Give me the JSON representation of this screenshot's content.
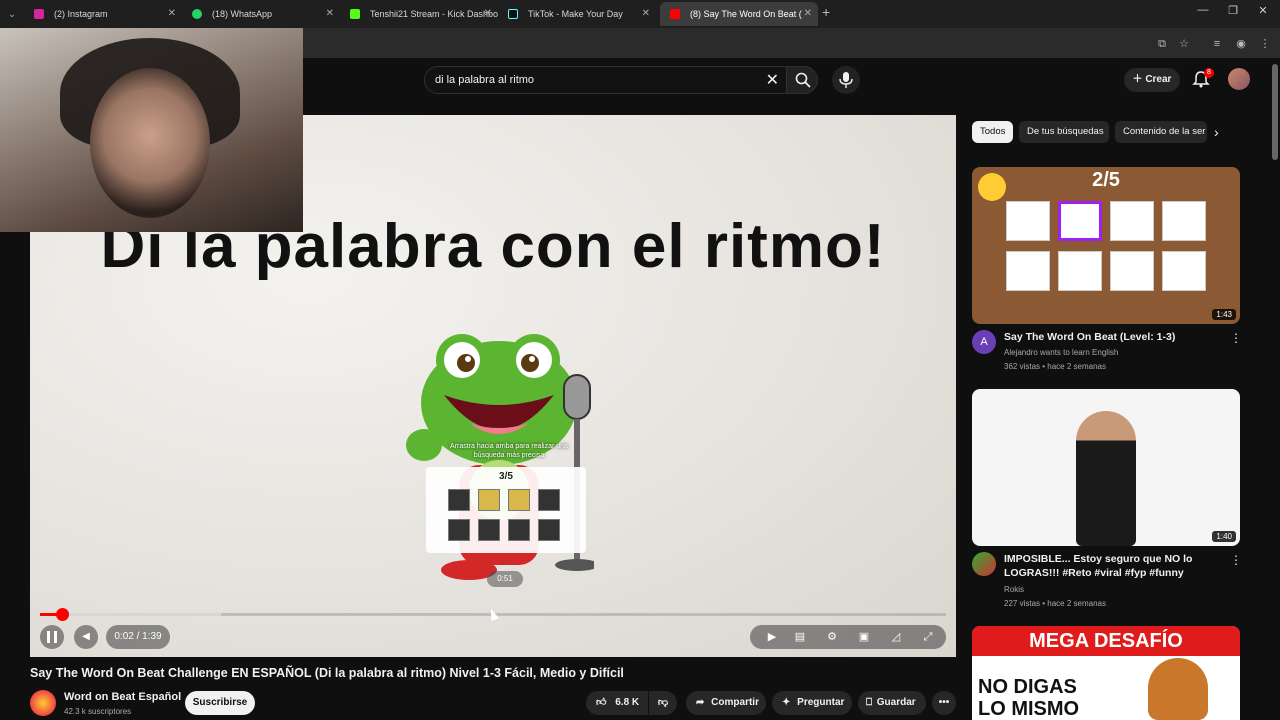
{
  "browser": {
    "tabs": [
      {
        "label": "(2) Instagram",
        "color": "#d6249f"
      },
      {
        "label": "(18) WhatsApp",
        "color": "#25d366"
      },
      {
        "label": "Tenshii21 Stream - Kick Dashbo",
        "color": "#53fc18"
      },
      {
        "label": "TikTok - Make Your Day",
        "color": "#111111"
      },
      {
        "label": "(8) Say The Word On Beat (",
        "color": "#ff0000"
      }
    ],
    "new_tab_label": "+",
    "tab_close": "✕",
    "minimize": "—",
    "restore": "❐",
    "close": "✕"
  },
  "header": {
    "search_value": "di la palabra al ritmo",
    "create_label": "Crear",
    "notif_count": "8"
  },
  "player": {
    "video_title_text": "Di la palabra con el ritmo!",
    "swipe_hint": "Arrastra hacia arriba para realizar una búsqueda más precisa",
    "mini_score": "3/5",
    "hover_time": "0:51",
    "time_display": "0:02 / 1:39",
    "progress_fraction": 0.024,
    "buffer_fraction": 0.2
  },
  "video": {
    "title": "Say The Word On Beat Challenge EN ESPAÑOL (Di la palabra al ritmo) Nivel 1-3 Fácil, Medio y Difícil",
    "channel": "Word on Beat Español",
    "subs": "42.3 k suscriptores",
    "subscribe_label": "Suscribirse",
    "likes": "6.8 K",
    "share_label": "Compartir",
    "ask_label": "Preguntar",
    "save_label": "Guardar"
  },
  "chips": [
    "Todos",
    "De tus búsquedas",
    "Contenido de la ser"
  ],
  "related": [
    {
      "title": "Say The Word On Beat (Level: 1-3)",
      "channel": "Alejandro wants to learn English",
      "meta": "362 vistas • hace 2 semanas",
      "duration": "1:43",
      "score": "2/5",
      "avatar_letter": "A"
    },
    {
      "title": "IMPOSIBLE... Estoy seguro que NO lo LOGRAS!!! #Reto #viral #fyp #funny",
      "channel": "Rokis",
      "meta": "227 vistas • hace 2 semanas",
      "duration": "1:40"
    },
    {
      "banner": "MEGA DESAFÍO",
      "line1": "NO DIGAS",
      "line2": "LO MISMO"
    }
  ]
}
